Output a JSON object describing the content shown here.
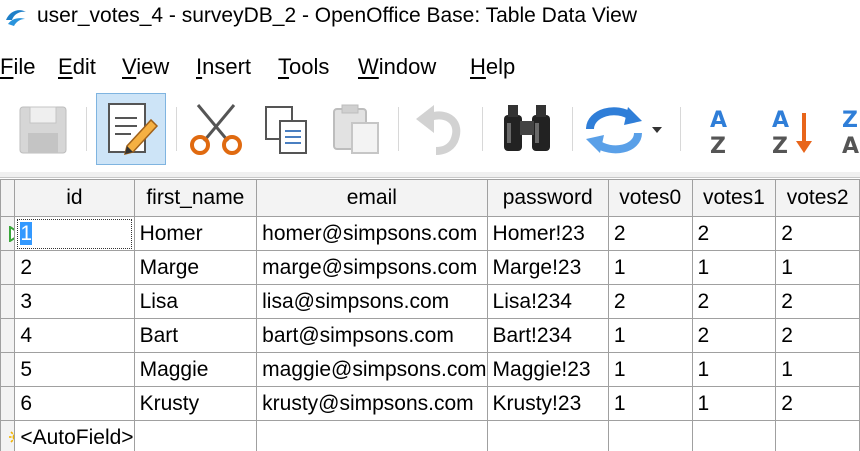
{
  "window": {
    "title": "user_votes_4 - surveyDB_2 - OpenOffice Base: Table Data View"
  },
  "menu": {
    "items": [
      {
        "accel": "F",
        "rest": "ile"
      },
      {
        "accel": "E",
        "rest": "dit"
      },
      {
        "accel": "V",
        "rest": "iew"
      },
      {
        "accel": "I",
        "rest": "nsert"
      },
      {
        "accel": "T",
        "rest": "ools"
      },
      {
        "accel": "W",
        "rest": "indow"
      },
      {
        "accel": "H",
        "rest": "elp"
      }
    ]
  },
  "toolbar": {
    "buttons": [
      "save",
      "edit-data",
      "cut",
      "copy",
      "paste",
      "undo",
      "find-record",
      "refresh",
      "sort-ascending",
      "sort-descending",
      "sort"
    ]
  },
  "table": {
    "columns": [
      "id",
      "first_name",
      "email",
      "password",
      "votes0",
      "votes1",
      "votes2"
    ],
    "rows": [
      {
        "id": "1",
        "first_name": "Homer",
        "email": "homer@simpsons.com",
        "password": "Homer!23",
        "votes0": "2",
        "votes1": "2",
        "votes2": "2"
      },
      {
        "id": "2",
        "first_name": "Marge",
        "email": "marge@simpsons.com",
        "password": "Marge!23",
        "votes0": "1",
        "votes1": "1",
        "votes2": "1"
      },
      {
        "id": "3",
        "first_name": "Lisa",
        "email": "lisa@simpsons.com",
        "password": "Lisa!234",
        "votes0": "2",
        "votes1": "2",
        "votes2": "2"
      },
      {
        "id": "4",
        "first_name": "Bart",
        "email": "bart@simpsons.com",
        "password": "Bart!234",
        "votes0": "1",
        "votes1": "2",
        "votes2": "2"
      },
      {
        "id": "5",
        "first_name": "Maggie",
        "email": "maggie@simpsons.com",
        "password": "Maggie!23",
        "votes0": "1",
        "votes1": "1",
        "votes2": "1"
      },
      {
        "id": "6",
        "first_name": "Krusty",
        "email": "krusty@simpsons.com",
        "password": "Krusty!23",
        "votes0": "1",
        "votes1": "1",
        "votes2": "2"
      }
    ],
    "new_row_placeholder": "<AutoField>",
    "current_row": 1
  },
  "colors": {
    "selection": "#3399ff",
    "current_marker": "#3aa63a",
    "new_marker": "#f2b400",
    "toolbar_active": "#cde4f7"
  }
}
